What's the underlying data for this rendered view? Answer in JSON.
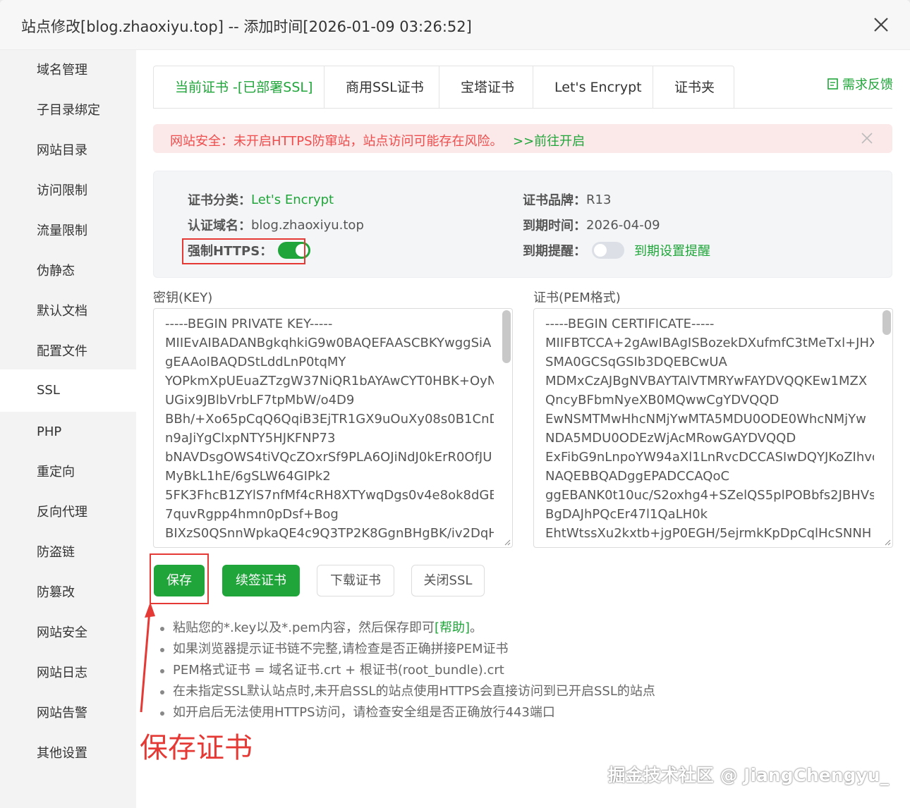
{
  "window": {
    "title": "站点修改[blog.zhaoxiyu.top] -- 添加时间[2026-01-09 03:26:52]"
  },
  "sidebar": {
    "items": [
      {
        "label": "域名管理"
      },
      {
        "label": "子目录绑定"
      },
      {
        "label": "网站目录"
      },
      {
        "label": "访问限制"
      },
      {
        "label": "流量限制"
      },
      {
        "label": "伪静态"
      },
      {
        "label": "默认文档"
      },
      {
        "label": "配置文件"
      },
      {
        "label": "SSL"
      },
      {
        "label": "PHP"
      },
      {
        "label": "重定向"
      },
      {
        "label": "反向代理"
      },
      {
        "label": "防盗链"
      },
      {
        "label": "防篡改"
      },
      {
        "label": "网站安全"
      },
      {
        "label": "网站日志"
      },
      {
        "label": "网站告警"
      },
      {
        "label": "其他设置"
      }
    ],
    "active": "SSL"
  },
  "tabs": [
    {
      "label": "当前证书 -[已部署SSL]"
    },
    {
      "label": "商用SSL证书"
    },
    {
      "label": "宝塔证书"
    },
    {
      "label": "Let's Encrypt"
    },
    {
      "label": "证书夹"
    }
  ],
  "feedback_label": "需求反馈",
  "alert": {
    "message": "网站安全：未开启HTTPS防窜站，站点访问可能存在风险。",
    "link": ">>前往开启"
  },
  "cert_info": {
    "category_label": "证书分类：",
    "category_value": "Let's Encrypt",
    "domain_label": "认证域名：",
    "domain_value": "blog.zhaoxiyu.top",
    "force_https_label": "强制HTTPS：",
    "force_https_on": true,
    "brand_label": "证书品牌：",
    "brand_value": "R13",
    "expire_label": "到期时间：",
    "expire_value": "2026-04-09",
    "reminder_label": "到期提醒：",
    "reminder_on": false,
    "reminder_link": "到期设置提醒"
  },
  "key_field": {
    "label": "密钥(KEY)",
    "value": "-----BEGIN PRIVATE KEY-----\nMIIEvAIBADANBgkqhkiG9w0BAQEFAASCBKYwggSiA\ngEAAoIBAQDStLddLnP0tqMY\nYOPkmXpUEuaZTzgW37NiQR1bAYAwCYT0HBK+OyN\nUGix9JBlbVrbLF7tpMbW/o4D9\nBBh/+Xo65pCqQ6QqiB3EjTR1GX9uOuXy08s0B1CnD\nn9aJiYgClxpNTY5HJKFNP73\nbNAVDsgOWS4tiVQcZOxrSf9PLA6OJiNdJ0kErR0OfJU\nMyBkL1hE/6gSLW64GIPk2\n5FK3FhcB1ZYlS7nfMf4cRH8XTYwqDgs0v4e8ok8dGBr\n7quvRgpp4hmn0pDsf+Bog\nBIXzS0QSnnWpkaQE4c9Q3TP2K8GgnBHgBK/iv2DqH"
  },
  "cert_field": {
    "label": "证书(PEM格式)",
    "value": "-----BEGIN CERTIFICATE-----\nMIIFBTCCA+2gAwIBAgISBozekDXufmfC3tMeTxl+JHX\nSMA0GCSqGSIb3DQEBCwUA\nMDMxCzAJBgNVBAYTAlVTMRYwFAYDVQQKEw1MZX\nQncyBFbmNyeXB0MQwwCgYDVQQD\nEwNSMTMwHhcNMjYwMTA5MDU0ODE0WhcNMjYw\nNDA5MDU0ODEzWjAcMRowGAYDVQQD\nExFibG9nLnpoYW94aXl1LnRvcDCCASIwDQYJKoZIhvc\nNAQEBBQADggEPADCCAQoC\nggEBANK0t10uc/S2oxhg4+SZelQS5plPOBbfs2JBHVs\nBgDAJhPQcEr47l1QaLH0k\nEhtWtssXu2kxtb+jgP0EGH/5ejrmkKpDpCqlHcSNNH"
  },
  "buttons": {
    "save": "保存",
    "renew": "续签证书",
    "download": "下载证书",
    "close_ssl": "关闭SSL"
  },
  "tips": {
    "tip1_before": "粘贴您的*.key以及*.pem内容，然后保存即可",
    "tip1_help": "[帮助]",
    "tip1_after": "。",
    "tip2": "如果浏览器提示证书链不完整,请检查是否正确拼接PEM证书",
    "tip3": "PEM格式证书 = 域名证书.crt + 根证书(root_bundle).crt",
    "tip4": "在未指定SSL默认站点时,未开启SSL的站点使用HTTPS会直接访问到已开启SSL的站点",
    "tip5": "如开启后无法使用HTTPS访问，请检查安全组是否正确放行443端口"
  },
  "annotation": "保存证书",
  "watermark": "掘金技术社区 @ JiangChengyu_",
  "colors": {
    "accent": "#20a53a",
    "danger": "#ef4d4d",
    "annotation": "#e53935"
  }
}
